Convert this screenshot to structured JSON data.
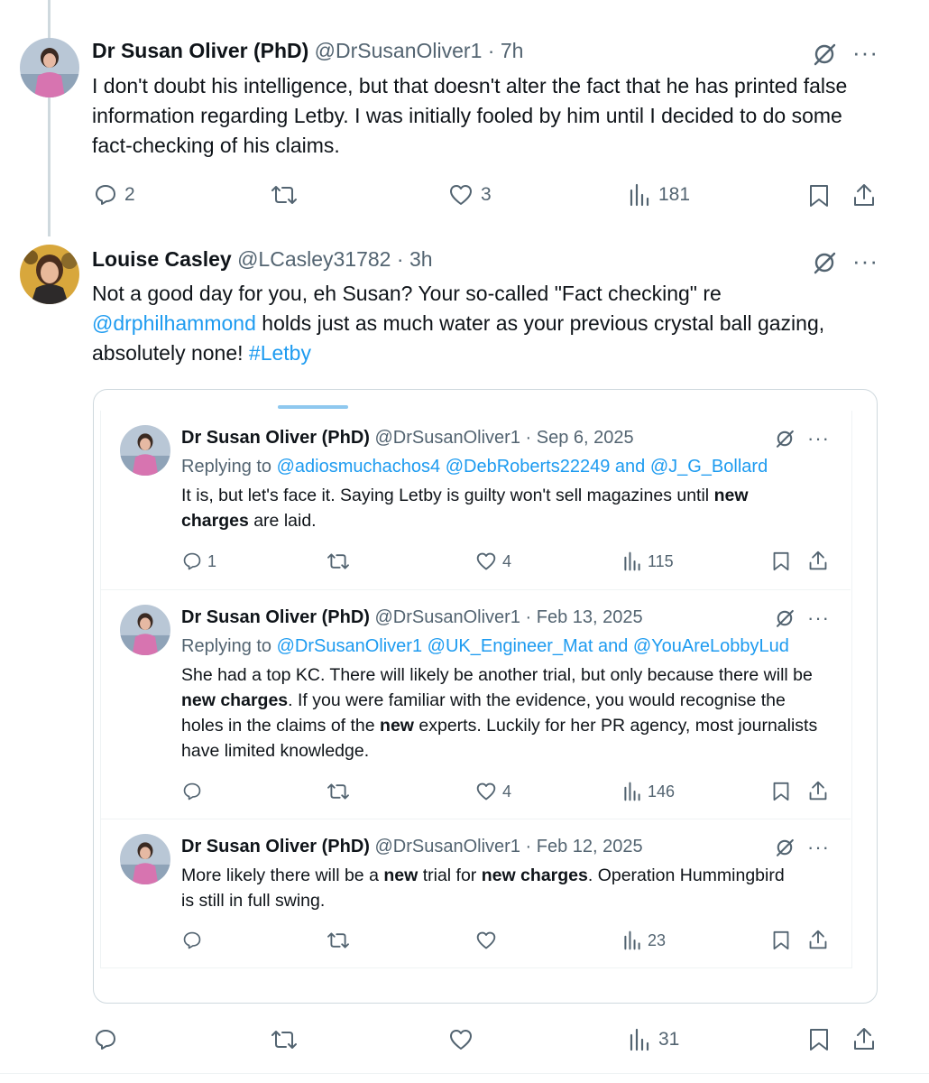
{
  "tweet1": {
    "name": "Dr Susan Oliver (PhD)",
    "handle": "@DrSusanOliver1",
    "sep": " · ",
    "time": "7h",
    "body": "I don't doubt his intelligence, but that doesn't alter the fact that he has printed false information regarding Letby. I was initially fooled by him until I decided to do some fact-checking of his claims.",
    "replies": "2",
    "likes": "3",
    "views": "181",
    "more": "···"
  },
  "tweet2": {
    "name": "Louise Casley",
    "handle": "@LCasley31782",
    "sep": " · ",
    "time": "3h",
    "body_before": "Not a good day for you, eh Susan? Your so-called \"Fact checking\" re ",
    "mention": "@drphilhammond",
    "body_after": " holds just as much water as your previous crystal ball gazing, absolutely none! ",
    "hashtag": "#Letby",
    "views": "31",
    "more": "···"
  },
  "quoted": [
    {
      "name": "Dr Susan Oliver (PhD)",
      "handle": "@DrSusanOliver1",
      "sep": " · ",
      "date": "Sep 6, 2025",
      "replying_label": "Replying to ",
      "reply_to_1": "@adiosmuchachos4",
      "reply_to_2": "@DebRoberts22249",
      "and": " and ",
      "reply_to_3": "@J_G_Bollard",
      "text_1": "It is, but let's face it. Saying Letby is guilty won't sell magazines until ",
      "bold_1": "new charges",
      "text_2": " are laid.",
      "replies": "1",
      "likes": "4",
      "views": "115",
      "more": "···"
    },
    {
      "name": "Dr Susan Oliver (PhD)",
      "handle": "@DrSusanOliver1",
      "sep": " · ",
      "date": "Feb 13, 2025",
      "replying_label": "Replying to ",
      "reply_to_1": "@DrSusanOliver1",
      "reply_to_2": "@UK_Engineer_Mat",
      "and": " and ",
      "reply_to_3": "@YouAreLobbyLud",
      "text_1": "She had a top KC. There will likely be another trial, but only because there will be ",
      "bold_1": "new charges",
      "text_2": ". If you were familiar with the evidence, you would recognise the holes in the claims of the ",
      "bold_2": "new",
      "text_3": " experts. Luckily for her PR agency, most journalists have limited knowledge.",
      "likes": "4",
      "views": "146",
      "more": "···"
    },
    {
      "name": "Dr Susan Oliver (PhD)",
      "handle": "@DrSusanOliver1",
      "sep": " · ",
      "date": "Feb 12, 2025",
      "text_1": "More likely there will be a ",
      "bold_1": "new",
      "text_2": " trial for ",
      "bold_2": "new charges",
      "text_3": ". Operation Hummingbird is still in full swing.",
      "views": "23",
      "more": "···"
    }
  ],
  "colors": {
    "link": "#1d9bf0",
    "muted": "#536471",
    "text": "#0f1419",
    "border": "#cfd9de"
  }
}
